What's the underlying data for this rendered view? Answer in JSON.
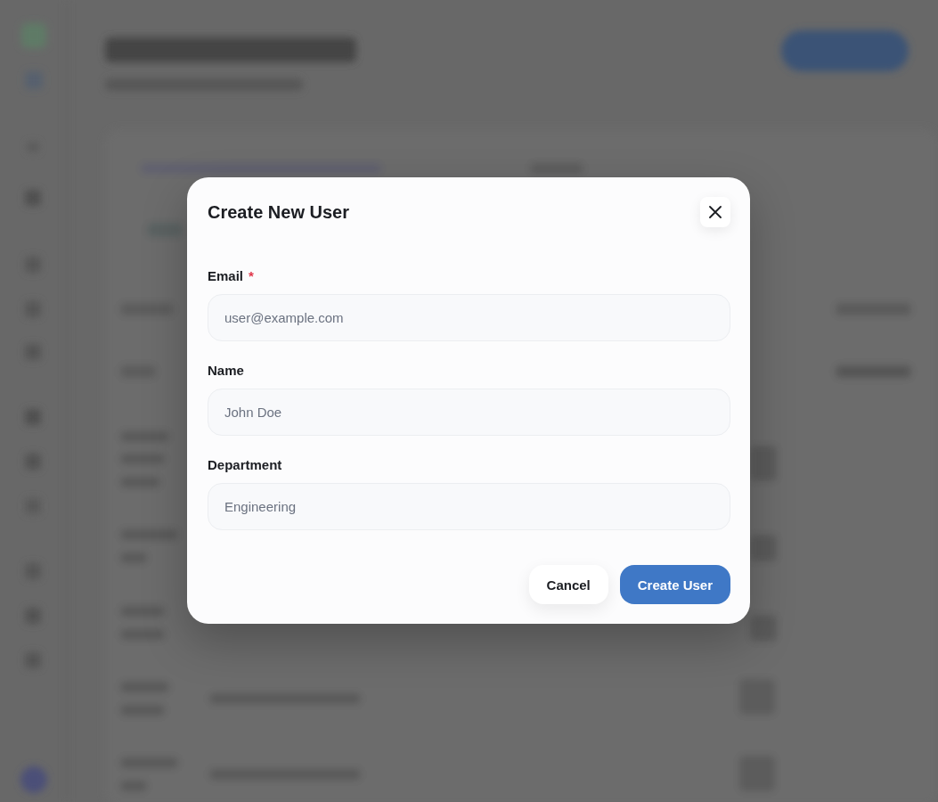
{
  "dialog": {
    "title": "Create New User",
    "fields": [
      {
        "label": "Email",
        "required_mark": "*",
        "placeholder": "user@example.com"
      },
      {
        "label": "Name",
        "placeholder": "John Doe"
      },
      {
        "label": "Department",
        "placeholder": "Engineering"
      }
    ],
    "buttons": [
      {
        "label": "Cancel",
        "kind": "secondary"
      },
      {
        "label": "Create User",
        "kind": "primary"
      }
    ]
  }
}
